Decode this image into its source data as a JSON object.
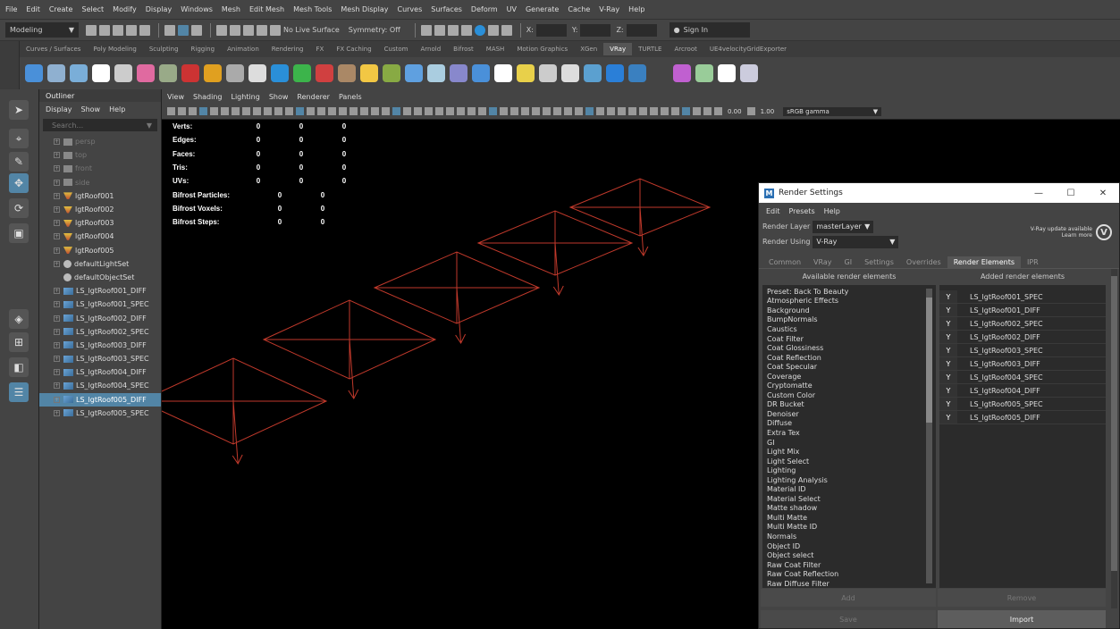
{
  "menubar": [
    "File",
    "Edit",
    "Create",
    "Select",
    "Modify",
    "Display",
    "Windows",
    "Mesh",
    "Edit Mesh",
    "Mesh Tools",
    "Mesh Display",
    "Curves",
    "Surfaces",
    "Deform",
    "UV",
    "Generate",
    "Cache",
    "V-Ray",
    "Help"
  ],
  "statusline": {
    "mode": "Modeling",
    "live_surface": "No Live Surface",
    "symmetry": "Symmetry: Off",
    "x_label": "X:",
    "y_label": "Y:",
    "z_label": "Z:",
    "sign_in": "Sign In"
  },
  "shelf_tabs": [
    "Curves / Surfaces",
    "Poly Modeling",
    "Sculpting",
    "Rigging",
    "Animation",
    "Rendering",
    "FX",
    "FX Caching",
    "Custom",
    "Arnold",
    "Bifrost",
    "MASH",
    "Motion Graphics",
    "XGen",
    "VRay",
    "TURTLE",
    "Arcroot",
    "UE4velocityGridExporter"
  ],
  "shelf_active": "VRay",
  "outliner": {
    "title": "Outliner",
    "menu": [
      "Display",
      "Show",
      "Help"
    ],
    "search_placeholder": "Search...",
    "items": [
      {
        "label": "persp",
        "icon": "camera-icon",
        "dim": true
      },
      {
        "label": "top",
        "icon": "camera-icon",
        "dim": true
      },
      {
        "label": "front",
        "icon": "camera-icon",
        "dim": true
      },
      {
        "label": "side",
        "icon": "camera-icon",
        "dim": true
      },
      {
        "label": "lgtRoof001",
        "icon": "light-icon"
      },
      {
        "label": "lgtRoof002",
        "icon": "light-icon"
      },
      {
        "label": "lgtRoof003",
        "icon": "light-icon"
      },
      {
        "label": "lgtRoof004",
        "icon": "light-icon"
      },
      {
        "label": "lgtRoof005",
        "icon": "light-icon"
      },
      {
        "label": "defaultLightSet",
        "icon": "set-icon"
      },
      {
        "label": "defaultObjectSet",
        "icon": "set-icon",
        "noexp": true
      },
      {
        "label": "LS_lgtRoof001_DIFF",
        "icon": "render-layer-icon"
      },
      {
        "label": "LS_lgtRoof001_SPEC",
        "icon": "render-layer-icon"
      },
      {
        "label": "LS_lgtRoof002_DIFF",
        "icon": "render-layer-icon"
      },
      {
        "label": "LS_lgtRoof002_SPEC",
        "icon": "render-layer-icon"
      },
      {
        "label": "LS_lgtRoof003_DIFF",
        "icon": "render-layer-icon"
      },
      {
        "label": "LS_lgtRoof003_SPEC",
        "icon": "render-layer-icon"
      },
      {
        "label": "LS_lgtRoof004_DIFF",
        "icon": "render-layer-icon"
      },
      {
        "label": "LS_lgtRoof004_SPEC",
        "icon": "render-layer-icon"
      },
      {
        "label": "LS_lgtRoof005_DIFF",
        "icon": "render-layer-icon",
        "selected": true
      },
      {
        "label": "LS_lgtRoof005_SPEC",
        "icon": "render-layer-icon"
      }
    ]
  },
  "viewport": {
    "menu": [
      "View",
      "Shading",
      "Lighting",
      "Show",
      "Renderer",
      "Panels"
    ],
    "field1": "0.00",
    "field2": "1.00",
    "gamma": "sRGB gamma",
    "hud": [
      {
        "label": "Verts:",
        "v": [
          "0",
          "0",
          "0"
        ]
      },
      {
        "label": "Edges:",
        "v": [
          "0",
          "0",
          "0"
        ]
      },
      {
        "label": "Faces:",
        "v": [
          "0",
          "0",
          "0"
        ]
      },
      {
        "label": "Tris:",
        "v": [
          "0",
          "0",
          "0"
        ]
      },
      {
        "label": "UVs:",
        "v": [
          "0",
          "0",
          "0"
        ]
      }
    ],
    "hud_bifrost": [
      {
        "label": "Bifrost Particles:",
        "v": [
          "0",
          "0"
        ]
      },
      {
        "label": "Bifrost Voxels:",
        "v": [
          "0",
          "0"
        ]
      },
      {
        "label": "Bifrost Steps:",
        "v": [
          "0",
          "0"
        ]
      }
    ]
  },
  "render_settings": {
    "title": "Render Settings",
    "menu": [
      "Edit",
      "Presets",
      "Help"
    ],
    "render_layer_label": "Render Layer",
    "render_layer_value": "masterLayer",
    "render_using_label": "Render Using",
    "render_using_value": "V-Ray",
    "update_line1": "V-Ray update available",
    "update_line2": "Learn more",
    "tabs": [
      "Common",
      "VRay",
      "GI",
      "Settings",
      "Overrides",
      "Render Elements",
      "IPR"
    ],
    "active_tab": "Render Elements",
    "available_header": "Available render elements",
    "added_header": "Added render elements",
    "available": [
      "Preset: Back To Beauty",
      "Atmospheric Effects",
      "Background",
      "BumpNormals",
      "Caustics",
      "Coat Filter",
      "Coat Glossiness",
      "Coat Reflection",
      "Coat Specular",
      "Coverage",
      "Cryptomatte",
      "Custom Color",
      "DR Bucket",
      "Denoiser",
      "Diffuse",
      "Extra Tex",
      "GI",
      "Light Mix",
      "Light Select",
      "Lighting",
      "Lighting Analysis",
      "Material ID",
      "Material Select",
      "Matte shadow",
      "Multi Matte",
      "Multi Matte ID",
      "Normals",
      "Object ID",
      "Object select",
      "Raw Coat Filter",
      "Raw Coat Reflection",
      "Raw Diffuse Filter"
    ],
    "added": [
      {
        "flag": "Y",
        "name": "LS_lgtRoof001_SPEC"
      },
      {
        "flag": "Y",
        "name": "LS_lgtRoof001_DIFF"
      },
      {
        "flag": "Y",
        "name": "LS_lgtRoof002_SPEC"
      },
      {
        "flag": "Y",
        "name": "LS_lgtRoof002_DIFF"
      },
      {
        "flag": "Y",
        "name": "LS_lgtRoof003_SPEC"
      },
      {
        "flag": "Y",
        "name": "LS_lgtRoof003_DIFF"
      },
      {
        "flag": "Y",
        "name": "LS_lgtRoof004_SPEC"
      },
      {
        "flag": "Y",
        "name": "LS_lgtRoof004_DIFF"
      },
      {
        "flag": "Y",
        "name": "LS_lgtRoof005_SPEC"
      },
      {
        "flag": "Y",
        "name": "LS_lgtRoof005_DIFF"
      }
    ],
    "btn_add": "Add",
    "btn_remove": "Remove",
    "btn_save": "Save",
    "btn_import": "Import"
  },
  "colors": {
    "accent": "#5285a6",
    "light_wire": "#c0392b",
    "panel": "#444444",
    "field": "#2b2b2b"
  }
}
